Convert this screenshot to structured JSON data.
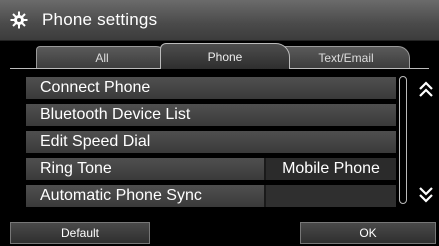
{
  "window": {
    "title": "Phone settings",
    "icon": "gear-icon"
  },
  "tabs": [
    {
      "label": "All",
      "active": false
    },
    {
      "label": "Phone",
      "active": true
    },
    {
      "label": "Text/Email",
      "active": false
    }
  ],
  "items": [
    {
      "label": "Connect Phone",
      "value": ""
    },
    {
      "label": "Bluetooth Device List",
      "value": ""
    },
    {
      "label": "Edit Speed Dial",
      "value": ""
    },
    {
      "label": "Ring Tone",
      "value": "Mobile Phone"
    },
    {
      "label": "Automatic Phone Sync",
      "value": ""
    }
  ],
  "scroll": {
    "up_icon": "double-chevron-up-icon",
    "down_icon": "double-chevron-down-icon"
  },
  "buttons": {
    "default_label": "Default",
    "ok_label": "OK"
  },
  "colors": {
    "background": "#000000",
    "row": "#454545",
    "title_bar": "#555555"
  }
}
